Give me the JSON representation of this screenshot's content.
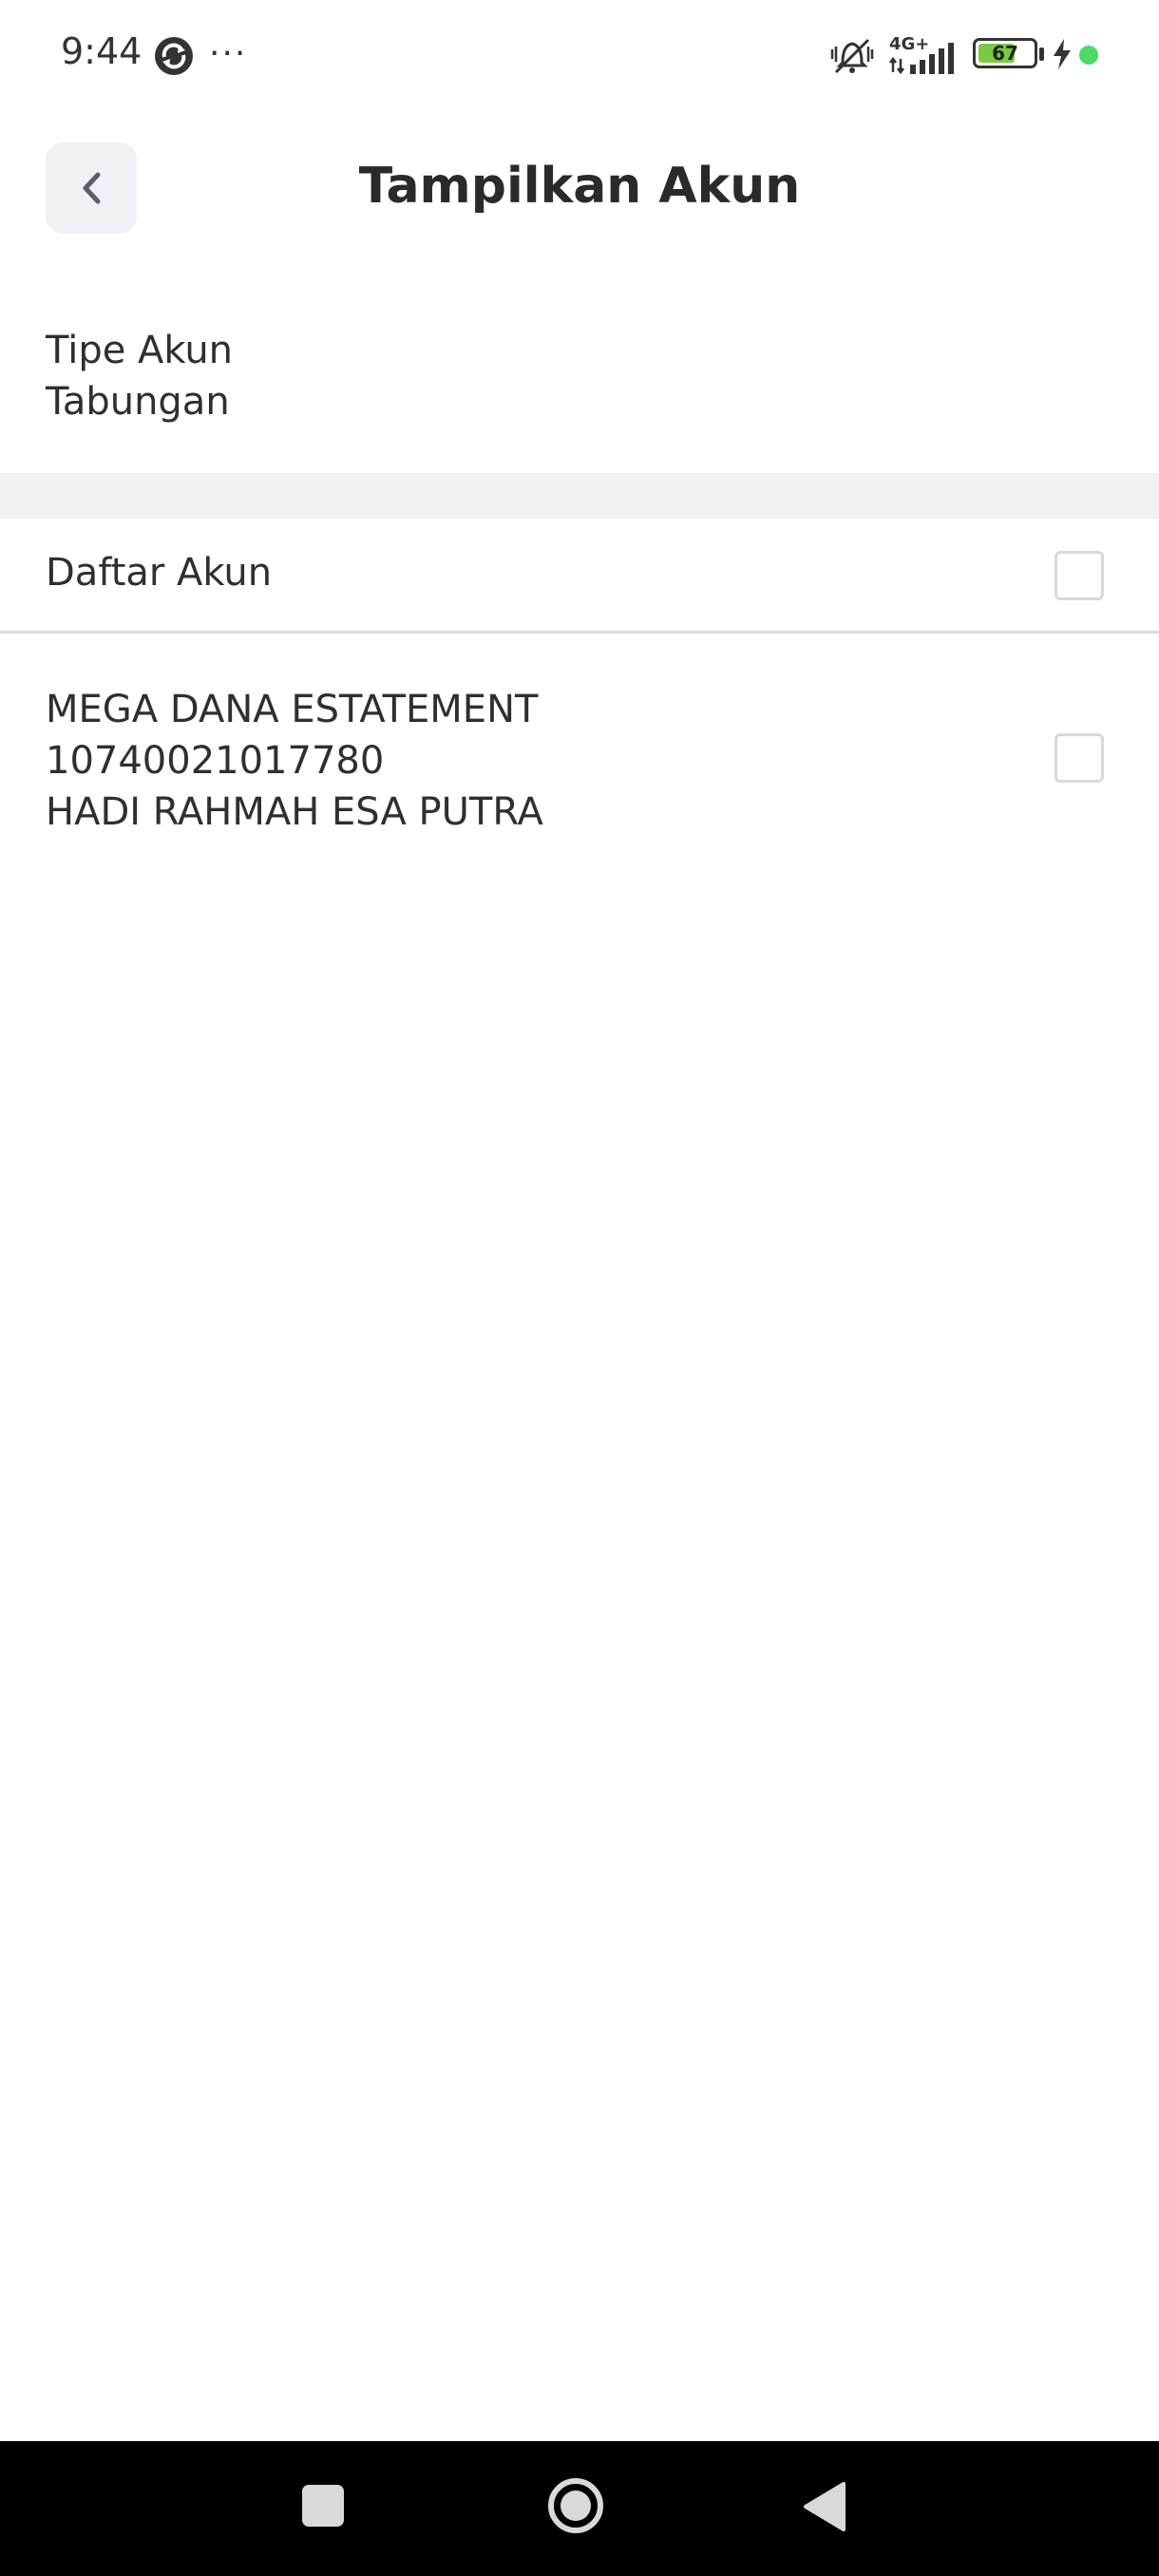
{
  "status_bar": {
    "time": "9:44",
    "more": "···",
    "network": "4G+",
    "battery_level": "67",
    "battery_fraction": 0.67,
    "icons": [
      "sync-icon",
      "mute-icon",
      "signal-icon",
      "battery-icon",
      "charging-bolt-icon",
      "status-dot"
    ],
    "accent_green": "#4cd964"
  },
  "header": {
    "back_icon": "chevron-left-icon",
    "title": "Tampilkan Akun"
  },
  "account_type": {
    "label": "Tipe Akun",
    "value": "Tabungan"
  },
  "account_list": {
    "header_label": "Daftar Akun",
    "select_all_checked": false,
    "items": [
      {
        "product": "MEGA DANA ESTATEMENT",
        "number": "10740021017780",
        "holder": "HADI RAHMAH ESA PUTRA",
        "checked": false
      }
    ]
  },
  "nav_bar": {
    "icons": [
      "recents-icon",
      "home-icon",
      "back-triangle-icon"
    ]
  }
}
